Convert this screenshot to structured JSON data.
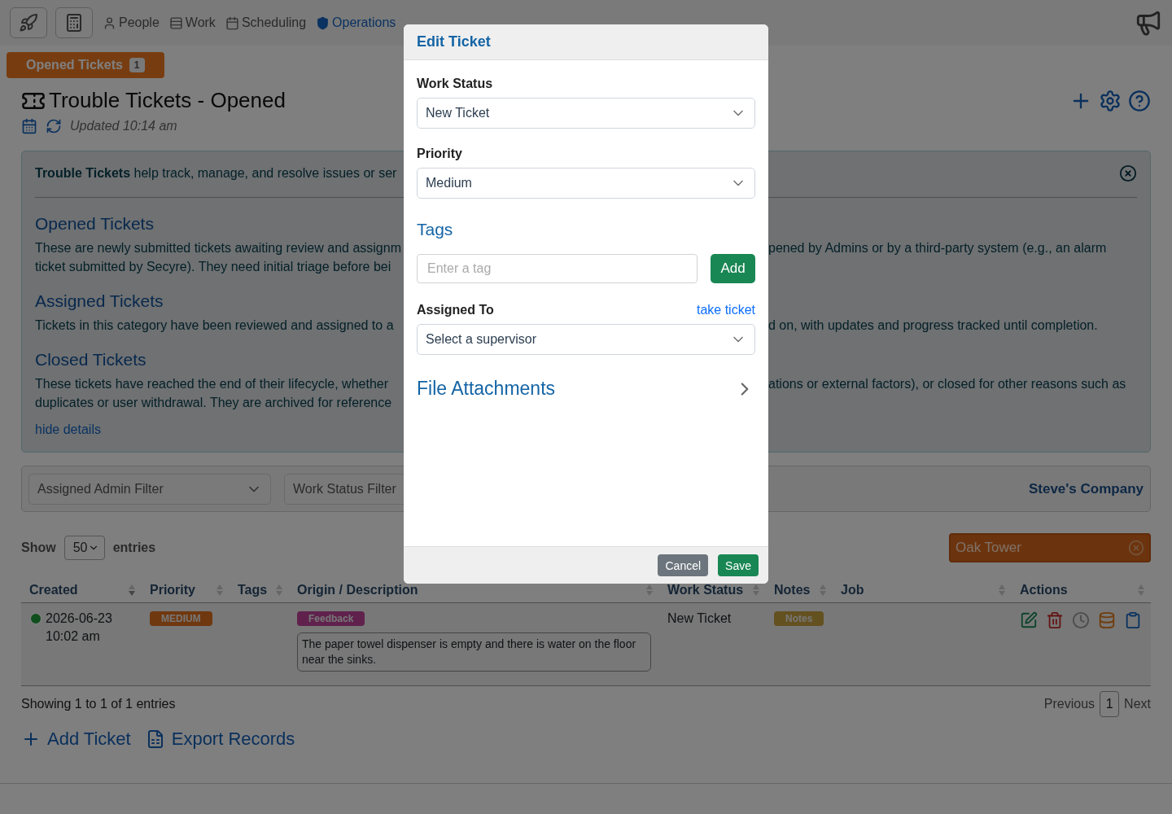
{
  "nav": {
    "items": [
      {
        "label": "People",
        "selected": false
      },
      {
        "label": "Work",
        "selected": false
      },
      {
        "label": "Scheduling",
        "selected": false
      },
      {
        "label": "Operations",
        "selected": true
      }
    ]
  },
  "tab": {
    "label": "Opened Tickets",
    "count": "1"
  },
  "title": "Trouble Tickets - Opened",
  "updated": "Updated 10:14 am",
  "info": {
    "intro": "**Trouble Tickets** help track, manage, and resolve issues or ser",
    "sections": [
      {
        "title": "Opened Tickets",
        "lines": [
          {
            "left": "These are newly submitted tickets awaiting review and assignm",
            "right": "pened by Admins or by a third-party system (e.g., an alarm"
          },
          {
            "left": "ticket submitted by Secyre). They need initial triage before bei"
          }
        ]
      },
      {
        "title": "Assigned Tickets",
        "lines": [
          {
            "left": "Tickets in this category have been reviewed and assigned to a",
            "right": "d on, with updates and progress tracked until completion."
          }
        ]
      },
      {
        "title": "Closed Tickets",
        "lines": [
          {
            "left": "These tickets have reached the end of their lifecycle, whether",
            "right": "ations or external factors), or closed for other reasons such as"
          },
          {
            "left": "duplicates or user withdrawal. They are archived for reference"
          }
        ]
      }
    ],
    "link": "hide details"
  },
  "filters": {
    "admin": "Assigned Admin Filter",
    "status": "Work Status Filter",
    "company": "Steve's Company"
  },
  "length": {
    "label": "Show",
    "value": "50",
    "suffix": "entries"
  },
  "location": "Oak Tower",
  "table": {
    "columns": [
      "Created",
      "Priority",
      "Tags",
      "Origin / Description",
      "Work Status",
      "Notes",
      "Job",
      "Actions"
    ],
    "rows": [
      {
        "date": "2026-06-23",
        "time": "10:02 am",
        "priority": "MEDIUM",
        "origin": "Feedback",
        "description": "The paper towel dispenser is empty and there is water on the floor near the sinks.",
        "work_status": "New Ticket",
        "notes": "Notes"
      }
    ]
  },
  "summary": "Showing 1 to 1 of 1 entries",
  "pagination": {
    "previous": "Previous",
    "pages": [
      {
        "label": "1",
        "selected": true
      }
    ],
    "next": "Next"
  },
  "bottom_actions": [
    "Add Ticket",
    "Export Records"
  ],
  "modal": {
    "title": "Edit Ticket",
    "work_status": {
      "label": "Work Status",
      "value": "New Ticket"
    },
    "priority": {
      "label": "Priority",
      "value": "Medium"
    },
    "tags": {
      "title": "Tags",
      "placeholder": "Enter a tag",
      "button": "Add"
    },
    "assigned": {
      "label": "Assigned To",
      "link": "take ticket",
      "value": "Select a supervisor"
    },
    "attachments": {
      "title": "File Attachments",
      "expanded": false
    },
    "buttons": [
      {
        "label": "Cancel",
        "kind": "secondary"
      },
      {
        "label": "Save",
        "kind": "primary"
      }
    ]
  }
}
